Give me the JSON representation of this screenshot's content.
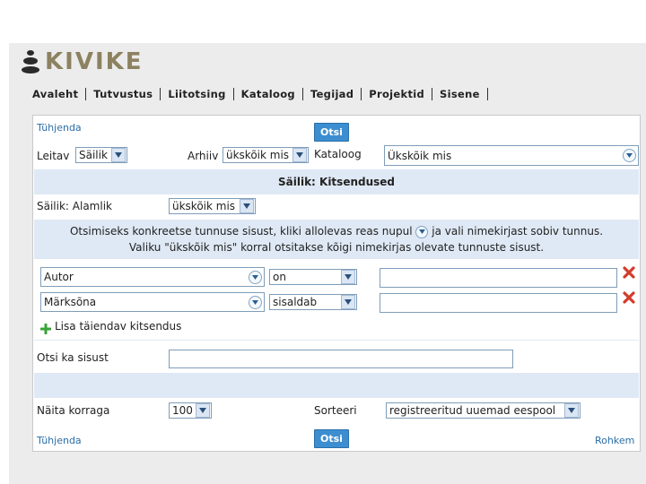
{
  "brand": {
    "name": "KIVIKE"
  },
  "nav": [
    {
      "label": "Avaleht"
    },
    {
      "label": "Tutvustus"
    },
    {
      "label": "Liitotsing"
    },
    {
      "label": "Kataloog"
    },
    {
      "label": "Tegijad"
    },
    {
      "label": "Projektid"
    },
    {
      "label": "Sisene"
    }
  ],
  "top": {
    "clear_label": "Tühjenda",
    "search_label": "Otsi"
  },
  "filters": {
    "leitav_label": "Leitav",
    "leitav_value": "Säilik",
    "arhiiv_label": "Arhiiv",
    "arhiiv_value": "ükskõik mis",
    "kataloog_label": "Kataloog",
    "kataloog_value": "Ükskõik mis"
  },
  "section_title": "Säilik: Kitsendused",
  "alamlik": {
    "label": "Säilik: Alamlik",
    "value": "ükskõik mis"
  },
  "info": {
    "line1_a": "Otsimiseks konkreetse tunnuse sisust, kliki allolevas reas nupul",
    "line1_b": "ja vali nimekirjast sobiv tunnus.",
    "line2": "Valiku \"ükskõik mis\" korral otsitakse kõigi nimekirjas olevate tunnuste sisust."
  },
  "criteria": [
    {
      "field": "Autor",
      "operator": "on",
      "value": ""
    },
    {
      "field": "Märksõna",
      "operator": "sisaldab",
      "value": ""
    }
  ],
  "add_label": "Lisa täiendav kitsendus",
  "content_search": {
    "label": "Otsi ka sisust",
    "value": ""
  },
  "display": {
    "count_label": "Näita korraga",
    "count_value": "100",
    "sort_label": "Sorteeri",
    "sort_value": "registreeritud uuemad eespool"
  },
  "bottom": {
    "clear_label": "Tühjenda",
    "search_label": "Otsi",
    "more_label": "Rohkem"
  },
  "colors": {
    "accent": "#3c8ed1",
    "band": "#dfe9f5",
    "link": "#2b6ea6",
    "brand": "#8c8260",
    "delete": "#d33b2c",
    "add": "#3aa23a"
  }
}
